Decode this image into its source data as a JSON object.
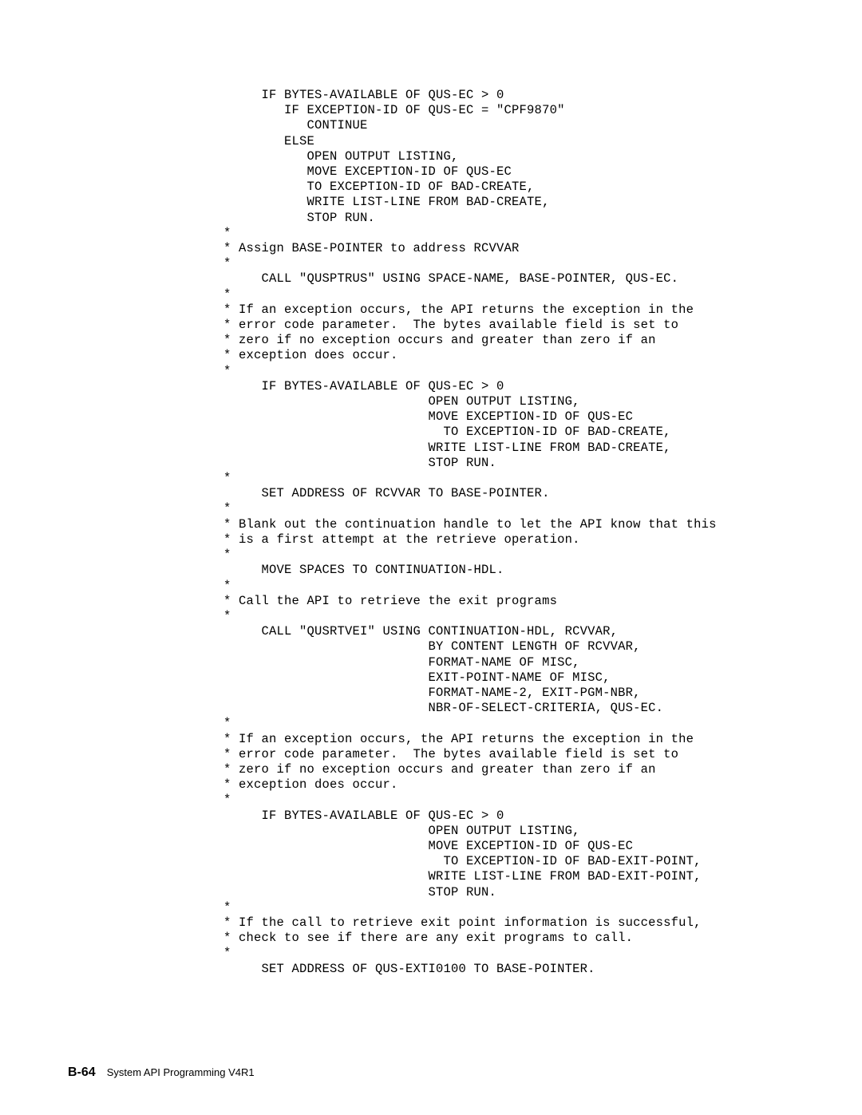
{
  "code": "     IF BYTES-AVAILABLE OF QUS-EC > 0\n        IF EXCEPTION-ID OF QUS-EC = \"CPF9870\"\n           CONTINUE\n        ELSE\n           OPEN OUTPUT LISTING,\n           MOVE EXCEPTION-ID OF QUS-EC\n           TO EXCEPTION-ID OF BAD-CREATE,\n           WRITE LIST-LINE FROM BAD-CREATE,\n           STOP RUN.\n*\n* Assign BASE-POINTER to address RCVVAR\n*\n     CALL \"QUSPTRUS\" USING SPACE-NAME, BASE-POINTER, QUS-EC.\n*\n* If an exception occurs, the API returns the exception in the\n* error code parameter.  The bytes available field is set to\n* zero if no exception occurs and greater than zero if an\n* exception does occur.\n*\n     IF BYTES-AVAILABLE OF QUS-EC > 0\n                           OPEN OUTPUT LISTING,\n                           MOVE EXCEPTION-ID OF QUS-EC\n                             TO EXCEPTION-ID OF BAD-CREATE,\n                           WRITE LIST-LINE FROM BAD-CREATE,\n                           STOP RUN.\n*\n     SET ADDRESS OF RCVVAR TO BASE-POINTER.\n*\n* Blank out the continuation handle to let the API know that this\n* is a first attempt at the retrieve operation.\n*\n     MOVE SPACES TO CONTINUATION-HDL.\n*\n* Call the API to retrieve the exit programs\n*\n     CALL \"QUSRTVEI\" USING CONTINUATION-HDL, RCVVAR,\n                           BY CONTENT LENGTH OF RCVVAR,\n                           FORMAT-NAME OF MISC,\n                           EXIT-POINT-NAME OF MISC,\n                           FORMAT-NAME-2, EXIT-PGM-NBR,\n                           NBR-OF-SELECT-CRITERIA, QUS-EC.\n*\n* If an exception occurs, the API returns the exception in the\n* error code parameter.  The bytes available field is set to\n* zero if no exception occurs and greater than zero if an\n* exception does occur.\n*\n     IF BYTES-AVAILABLE OF QUS-EC > 0\n                           OPEN OUTPUT LISTING,\n                           MOVE EXCEPTION-ID OF QUS-EC\n                             TO EXCEPTION-ID OF BAD-EXIT-POINT,\n                           WRITE LIST-LINE FROM BAD-EXIT-POINT,\n                           STOP RUN.\n*\n* If the call to retrieve exit point information is successful,\n* check to see if there are any exit programs to call.\n*\n     SET ADDRESS OF QUS-EXTI0100 TO BASE-POINTER.",
  "footer": {
    "page": "B-64",
    "title": "System API Programming V4R1"
  }
}
